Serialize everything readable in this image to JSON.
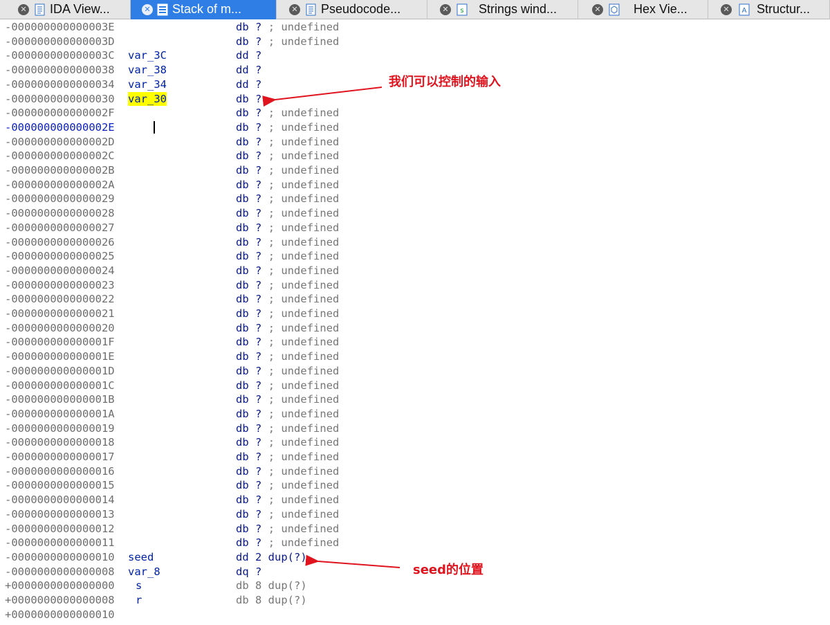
{
  "tabs": [
    {
      "label": "IDA View...",
      "icon": "ida-view-icon",
      "active": false
    },
    {
      "label": "Stack of m...",
      "icon": "stack-frame-icon",
      "active": true
    },
    {
      "label": "Pseudocode...",
      "icon": "pseudocode-icon",
      "active": false
    },
    {
      "label": "Strings wind...",
      "icon": "strings-icon",
      "active": false
    },
    {
      "label": "Hex Vie...",
      "icon": "hex-view-icon",
      "active": false
    },
    {
      "label": "Structur...",
      "icon": "structures-icon",
      "active": false
    }
  ],
  "stack_rows": [
    {
      "addr": "-000000000000003E",
      "name": "",
      "type": "db",
      "value": "?",
      "comment": "; undefined"
    },
    {
      "addr": "-000000000000003D",
      "name": "",
      "type": "db",
      "value": "?",
      "comment": "; undefined"
    },
    {
      "addr": "-000000000000003C",
      "name": "var_3C",
      "type": "dd",
      "value": "?",
      "comment": ""
    },
    {
      "addr": "-0000000000000038",
      "name": "var_38",
      "type": "dd",
      "value": "?",
      "comment": ""
    },
    {
      "addr": "-0000000000000034",
      "name": "var_34",
      "type": "dd",
      "value": "?",
      "comment": ""
    },
    {
      "addr": "-0000000000000030",
      "name": "var_30",
      "type": "db",
      "value": "?",
      "comment": "",
      "highlight": true
    },
    {
      "addr": "-000000000000002F",
      "name": "",
      "type": "db",
      "value": "?",
      "comment": "; undefined"
    },
    {
      "addr": "-000000000000002E",
      "name": "",
      "type": "db",
      "value": "?",
      "comment": "; undefined",
      "current": true
    },
    {
      "addr": "-000000000000002D",
      "name": "",
      "type": "db",
      "value": "?",
      "comment": "; undefined"
    },
    {
      "addr": "-000000000000002C",
      "name": "",
      "type": "db",
      "value": "?",
      "comment": "; undefined"
    },
    {
      "addr": "-000000000000002B",
      "name": "",
      "type": "db",
      "value": "?",
      "comment": "; undefined"
    },
    {
      "addr": "-000000000000002A",
      "name": "",
      "type": "db",
      "value": "?",
      "comment": "; undefined"
    },
    {
      "addr": "-0000000000000029",
      "name": "",
      "type": "db",
      "value": "?",
      "comment": "; undefined"
    },
    {
      "addr": "-0000000000000028",
      "name": "",
      "type": "db",
      "value": "?",
      "comment": "; undefined"
    },
    {
      "addr": "-0000000000000027",
      "name": "",
      "type": "db",
      "value": "?",
      "comment": "; undefined"
    },
    {
      "addr": "-0000000000000026",
      "name": "",
      "type": "db",
      "value": "?",
      "comment": "; undefined"
    },
    {
      "addr": "-0000000000000025",
      "name": "",
      "type": "db",
      "value": "?",
      "comment": "; undefined"
    },
    {
      "addr": "-0000000000000024",
      "name": "",
      "type": "db",
      "value": "?",
      "comment": "; undefined"
    },
    {
      "addr": "-0000000000000023",
      "name": "",
      "type": "db",
      "value": "?",
      "comment": "; undefined"
    },
    {
      "addr": "-0000000000000022",
      "name": "",
      "type": "db",
      "value": "?",
      "comment": "; undefined"
    },
    {
      "addr": "-0000000000000021",
      "name": "",
      "type": "db",
      "value": "?",
      "comment": "; undefined"
    },
    {
      "addr": "-0000000000000020",
      "name": "",
      "type": "db",
      "value": "?",
      "comment": "; undefined"
    },
    {
      "addr": "-000000000000001F",
      "name": "",
      "type": "db",
      "value": "?",
      "comment": "; undefined"
    },
    {
      "addr": "-000000000000001E",
      "name": "",
      "type": "db",
      "value": "?",
      "comment": "; undefined"
    },
    {
      "addr": "-000000000000001D",
      "name": "",
      "type": "db",
      "value": "?",
      "comment": "; undefined"
    },
    {
      "addr": "-000000000000001C",
      "name": "",
      "type": "db",
      "value": "?",
      "comment": "; undefined"
    },
    {
      "addr": "-000000000000001B",
      "name": "",
      "type": "db",
      "value": "?",
      "comment": "; undefined"
    },
    {
      "addr": "-000000000000001A",
      "name": "",
      "type": "db",
      "value": "?",
      "comment": "; undefined"
    },
    {
      "addr": "-0000000000000019",
      "name": "",
      "type": "db",
      "value": "?",
      "comment": "; undefined"
    },
    {
      "addr": "-0000000000000018",
      "name": "",
      "type": "db",
      "value": "?",
      "comment": "; undefined"
    },
    {
      "addr": "-0000000000000017",
      "name": "",
      "type": "db",
      "value": "?",
      "comment": "; undefined"
    },
    {
      "addr": "-0000000000000016",
      "name": "",
      "type": "db",
      "value": "?",
      "comment": "; undefined"
    },
    {
      "addr": "-0000000000000015",
      "name": "",
      "type": "db",
      "value": "?",
      "comment": "; undefined"
    },
    {
      "addr": "-0000000000000014",
      "name": "",
      "type": "db",
      "value": "?",
      "comment": "; undefined"
    },
    {
      "addr": "-0000000000000013",
      "name": "",
      "type": "db",
      "value": "?",
      "comment": "; undefined"
    },
    {
      "addr": "-0000000000000012",
      "name": "",
      "type": "db",
      "value": "?",
      "comment": "; undefined"
    },
    {
      "addr": "-0000000000000011",
      "name": "",
      "type": "db",
      "value": "?",
      "comment": "; undefined"
    },
    {
      "addr": "-0000000000000010",
      "name": "seed",
      "type": "dd",
      "value": "2 dup(?)",
      "comment": ""
    },
    {
      "addr": "-0000000000000008",
      "name": "var_8",
      "type": "dq",
      "value": "?",
      "comment": ""
    },
    {
      "addr": "+0000000000000000",
      "name": "s",
      "type": "db",
      "value": "8 dup(?)",
      "comment": "",
      "special": true
    },
    {
      "addr": "+0000000000000008",
      "name": "r",
      "type": "db",
      "value": "8 dup(?)",
      "comment": "",
      "special": true
    },
    {
      "addr": "+0000000000000010",
      "name": "",
      "type": "",
      "value": "",
      "comment": ""
    }
  ],
  "annotations": {
    "input_note": "我们可以控制的输入",
    "seed_note": "seed的位置",
    "color": "#e0141e"
  }
}
